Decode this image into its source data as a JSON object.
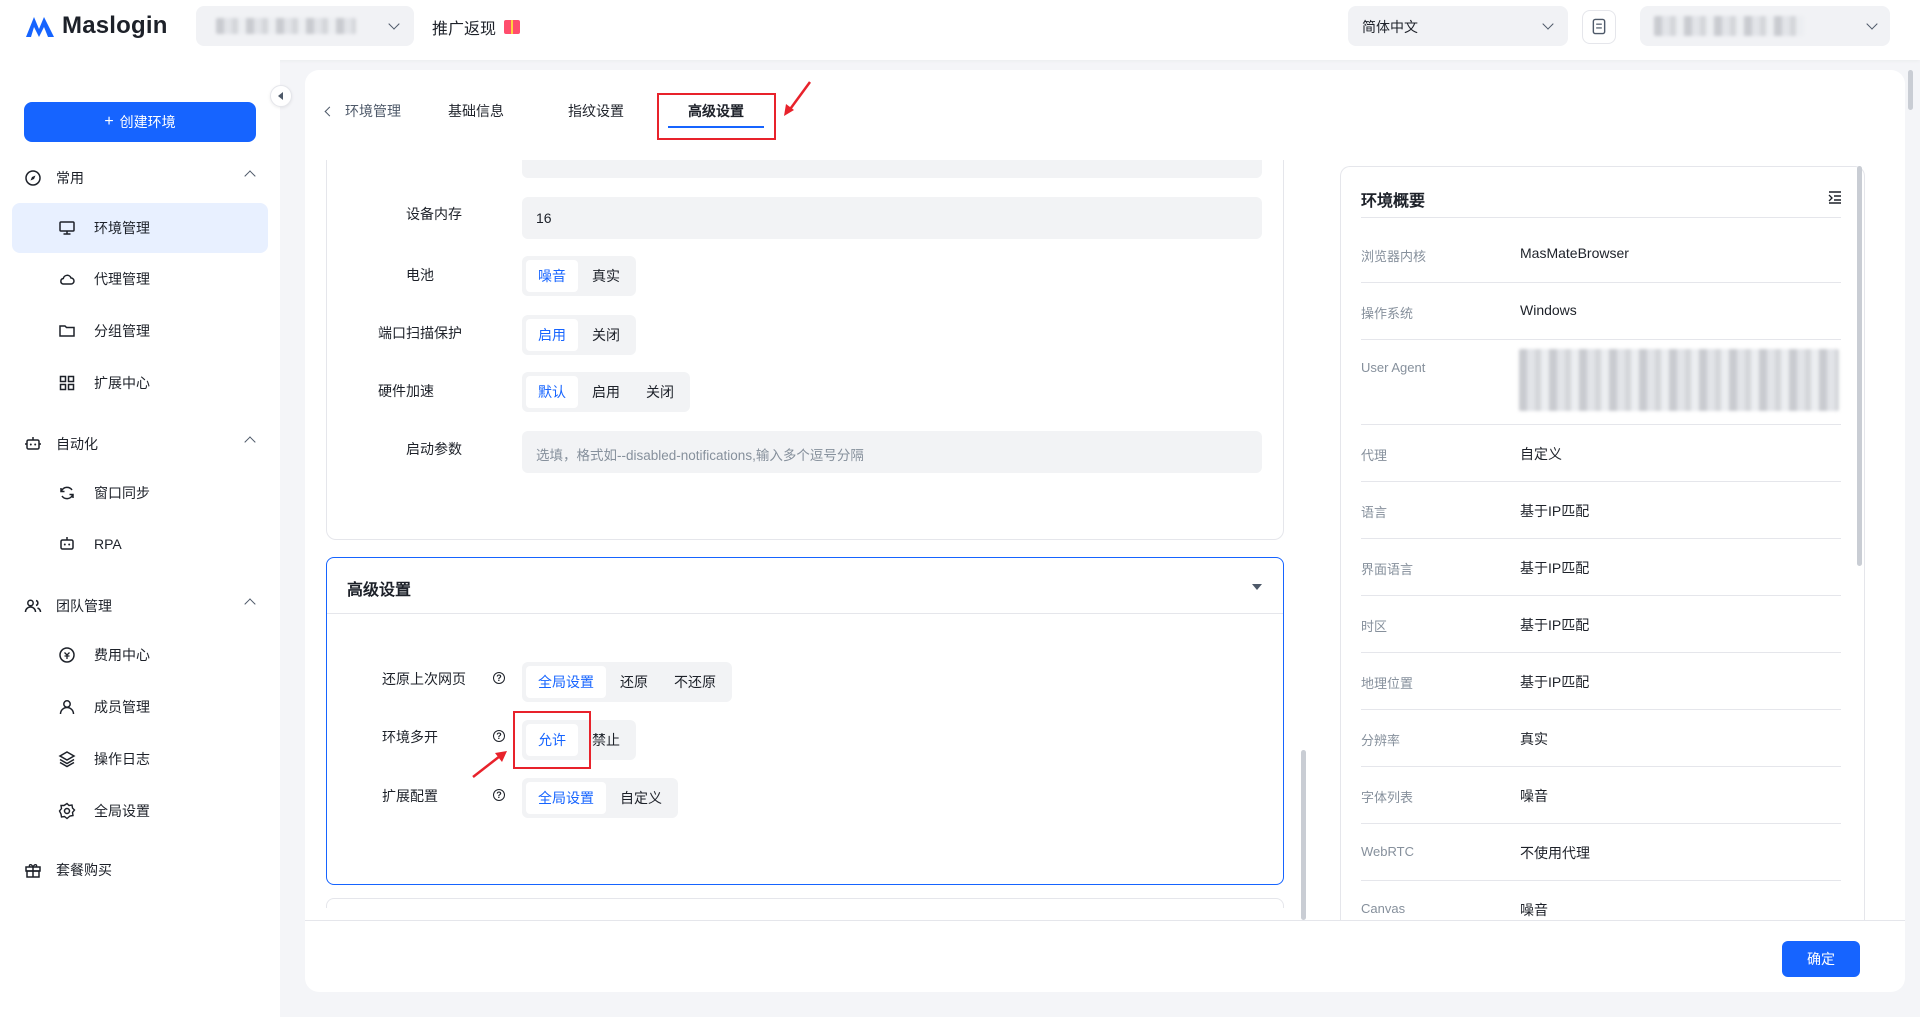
{
  "app": {
    "brand": "Maslogin"
  },
  "topbar": {
    "promo_label": "推广返现",
    "language": "简体中文"
  },
  "sidebar": {
    "create_button": "创建环境",
    "groups": [
      {
        "label": "常用",
        "items": [
          {
            "label": "环境管理",
            "icon": "monitor-icon",
            "active": true
          },
          {
            "label": "代理管理",
            "icon": "cloud-icon"
          },
          {
            "label": "分组管理",
            "icon": "folder-icon"
          },
          {
            "label": "扩展中心",
            "icon": "grid-icon"
          }
        ]
      },
      {
        "label": "自动化",
        "items": [
          {
            "label": "窗口同步",
            "icon": "sync-icon"
          },
          {
            "label": "RPA",
            "icon": "robot-icon"
          }
        ]
      },
      {
        "label": "团队管理",
        "items": [
          {
            "label": "费用中心",
            "icon": "coin-icon"
          },
          {
            "label": "成员管理",
            "icon": "user-icon"
          },
          {
            "label": "操作日志",
            "icon": "layers-icon"
          },
          {
            "label": "全局设置",
            "icon": "gear-icon"
          }
        ]
      }
    ],
    "bottom_item": "套餐购买"
  },
  "tabs": {
    "back_label": "环境管理",
    "items": [
      "基础信息",
      "指纹设置",
      "高级设置"
    ],
    "active": "高级设置"
  },
  "fingerprint_form": {
    "memory_label": "设备内存",
    "memory_value": "16",
    "battery_label": "电池",
    "battery_options": [
      "噪音",
      "真实"
    ],
    "port_label": "端口扫描保护",
    "port_options": [
      "启用",
      "关闭"
    ],
    "hw_label": "硬件加速",
    "hw_options": [
      "默认",
      "启用",
      "关闭"
    ],
    "launch_label": "启动参数",
    "launch_placeholder": "选填，格式如--disabled-notifications,输入多个逗号分隔"
  },
  "advanced": {
    "title": "高级设置",
    "restore_label": "还原上次网页",
    "restore_options": [
      "全局设置",
      "还原",
      "不还原"
    ],
    "multi_label": "环境多开",
    "multi_options": [
      "允许",
      "禁止"
    ],
    "ext_label": "扩展配置",
    "ext_options": [
      "全局设置",
      "自定义"
    ]
  },
  "summary": {
    "title": "环境概要",
    "rows": [
      {
        "key": "浏览器内核",
        "value": "MasMateBrowser"
      },
      {
        "key": "操作系统",
        "value": "Windows"
      },
      {
        "key": "User Agent",
        "value": ""
      },
      {
        "key": "代理",
        "value": "自定义"
      },
      {
        "key": "语言",
        "value": "基于IP匹配"
      },
      {
        "key": "界面语言",
        "value": "基于IP匹配"
      },
      {
        "key": "时区",
        "value": "基于IP匹配"
      },
      {
        "key": "地理位置",
        "value": "基于IP匹配"
      },
      {
        "key": "分辨率",
        "value": "真实"
      },
      {
        "key": "字体列表",
        "value": "噪音"
      },
      {
        "key": "WebRTC",
        "value": "不使用代理"
      },
      {
        "key": "Canvas",
        "value": "噪音"
      }
    ]
  },
  "footer": {
    "confirm": "确定"
  },
  "colors": {
    "accent": "#1664ff",
    "annotation": "#e8222b"
  }
}
